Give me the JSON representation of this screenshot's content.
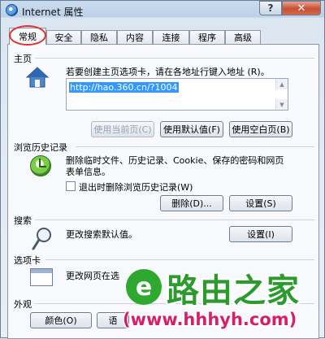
{
  "window": {
    "title": "Internet 属性",
    "help_label": "?",
    "close_label": "✕"
  },
  "tabs": [
    "常规",
    "安全",
    "隐私",
    "内容",
    "连接",
    "程序",
    "高级"
  ],
  "home_page": {
    "group_label": "主页",
    "description": "若要创建主页选项卡，请在各地址行键入地址 (R)。",
    "url": "http://hao.360.cn/?1004",
    "buttons": [
      "使用当前页(C)",
      "使用默认值(F)",
      "使用空白页(B)"
    ]
  },
  "history": {
    "group_label": "浏览历史记录",
    "description_line1": "删除临时文件、历史记录、Cookie、保存的密码和网页",
    "description_line2": "表单信息。",
    "checkbox_label": "退出时删除浏览历史记录(W)",
    "buttons": [
      "删除(D)...",
      "设置(S)"
    ]
  },
  "search": {
    "group_label": "搜索",
    "description": "更改搜索默认值。",
    "button": "设置(I)"
  },
  "tabs_section": {
    "group_label": "选项卡",
    "description": "更改网页在选"
  },
  "appearance": {
    "group_label": "外观",
    "buttons": [
      "颜色(O)",
      "语"
    ]
  },
  "watermark": {
    "logo_char": "e",
    "text": "路由之家",
    "url": "(www.hhhyh.com)"
  },
  "colors": {
    "accent_blue": "#3399ff",
    "close_red": "#c64f32",
    "watermark_green": "#2c9a2c",
    "watermark_pink": "#d81e6a"
  }
}
